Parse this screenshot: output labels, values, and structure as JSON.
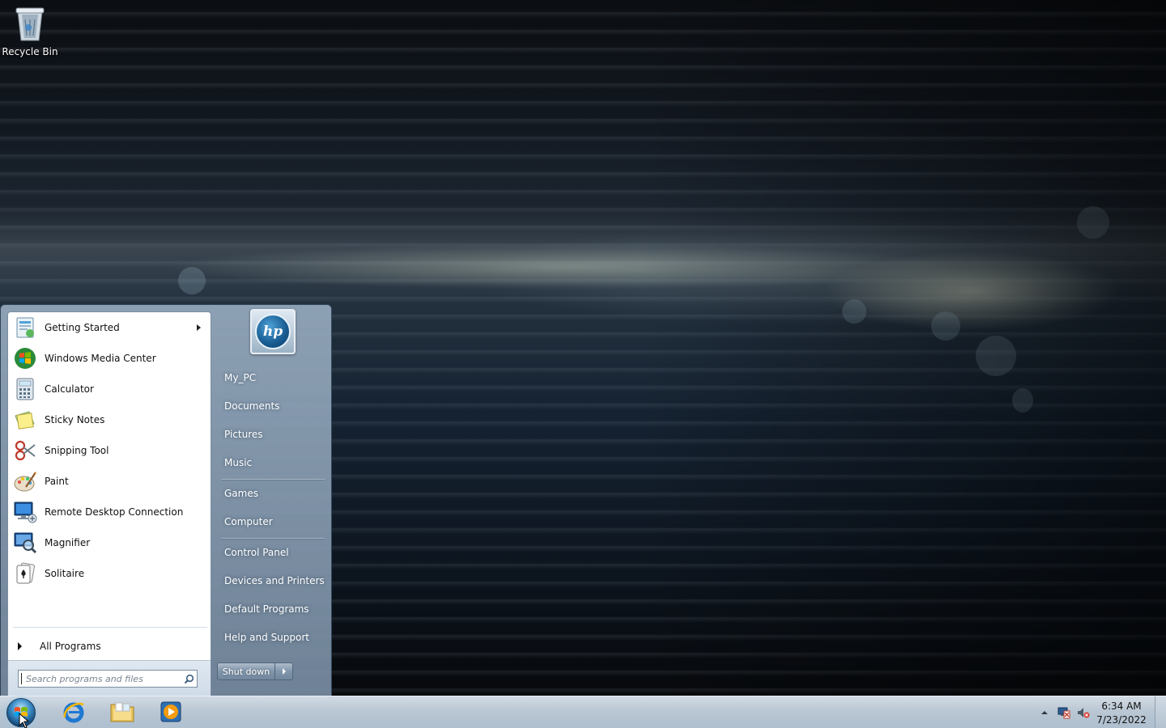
{
  "desktop": {
    "icons": [
      {
        "label": "Recycle Bin",
        "icon": "recycle-bin-icon"
      }
    ]
  },
  "start_menu": {
    "programs": [
      {
        "label": "Getting Started",
        "icon": "getting-started-icon",
        "has_submenu": true
      },
      {
        "label": "Windows Media Center",
        "icon": "windows-media-center-icon"
      },
      {
        "label": "Calculator",
        "icon": "calculator-icon"
      },
      {
        "label": "Sticky Notes",
        "icon": "sticky-notes-icon"
      },
      {
        "label": "Snipping Tool",
        "icon": "snipping-tool-icon"
      },
      {
        "label": "Paint",
        "icon": "paint-icon"
      },
      {
        "label": "Remote Desktop Connection",
        "icon": "remote-desktop-icon"
      },
      {
        "label": "Magnifier",
        "icon": "magnifier-icon"
      },
      {
        "label": "Solitaire",
        "icon": "solitaire-icon"
      }
    ],
    "all_programs_label": "All Programs",
    "search_placeholder": "Search programs and files",
    "places": [
      {
        "label": "My_PC"
      },
      {
        "label": "Documents"
      },
      {
        "label": "Pictures"
      },
      {
        "label": "Music"
      },
      {
        "label": "Games"
      },
      {
        "label": "Computer"
      },
      {
        "label": "Control Panel"
      },
      {
        "label": "Devices and Printers"
      },
      {
        "label": "Default Programs"
      },
      {
        "label": "Help and Support"
      }
    ],
    "user_picture": "hp",
    "shutdown_label": "Shut down"
  },
  "taskbar": {
    "pinned": [
      {
        "icon": "internet-explorer-icon"
      },
      {
        "icon": "windows-explorer-icon"
      },
      {
        "icon": "windows-media-player-icon"
      }
    ],
    "tray": {
      "icons": [
        "show-hidden-icons-icon",
        "network-icon",
        "volume-muted-icon"
      ],
      "time": "6:34 AM",
      "date": "7/23/2022"
    }
  }
}
